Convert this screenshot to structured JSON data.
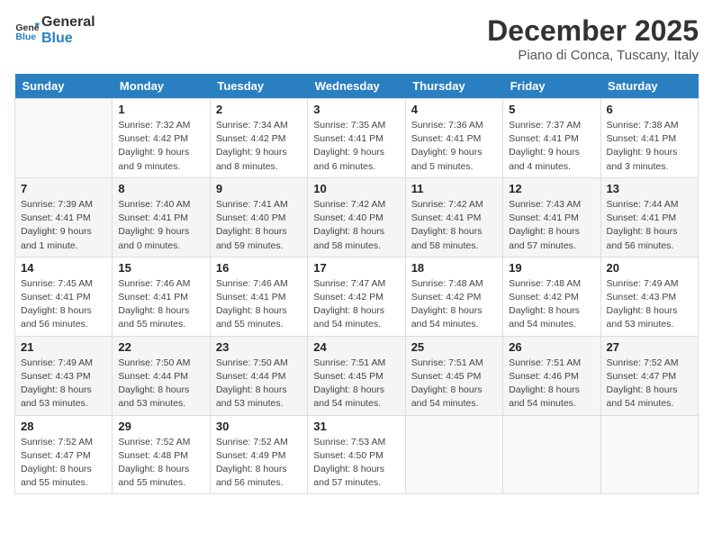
{
  "header": {
    "logo_line1": "General",
    "logo_line2": "Blue",
    "month": "December 2025",
    "location": "Piano di Conca, Tuscany, Italy"
  },
  "weekdays": [
    "Sunday",
    "Monday",
    "Tuesday",
    "Wednesday",
    "Thursday",
    "Friday",
    "Saturday"
  ],
  "weeks": [
    [
      {
        "day": "",
        "sunrise": "",
        "sunset": "",
        "daylight": ""
      },
      {
        "day": "1",
        "sunrise": "7:32 AM",
        "sunset": "4:42 PM",
        "daylight": "9 hours and 9 minutes."
      },
      {
        "day": "2",
        "sunrise": "7:34 AM",
        "sunset": "4:42 PM",
        "daylight": "9 hours and 8 minutes."
      },
      {
        "day": "3",
        "sunrise": "7:35 AM",
        "sunset": "4:41 PM",
        "daylight": "9 hours and 6 minutes."
      },
      {
        "day": "4",
        "sunrise": "7:36 AM",
        "sunset": "4:41 PM",
        "daylight": "9 hours and 5 minutes."
      },
      {
        "day": "5",
        "sunrise": "7:37 AM",
        "sunset": "4:41 PM",
        "daylight": "9 hours and 4 minutes."
      },
      {
        "day": "6",
        "sunrise": "7:38 AM",
        "sunset": "4:41 PM",
        "daylight": "9 hours and 3 minutes."
      }
    ],
    [
      {
        "day": "7",
        "sunrise": "7:39 AM",
        "sunset": "4:41 PM",
        "daylight": "9 hours and 1 minute."
      },
      {
        "day": "8",
        "sunrise": "7:40 AM",
        "sunset": "4:41 PM",
        "daylight": "9 hours and 0 minutes."
      },
      {
        "day": "9",
        "sunrise": "7:41 AM",
        "sunset": "4:40 PM",
        "daylight": "8 hours and 59 minutes."
      },
      {
        "day": "10",
        "sunrise": "7:42 AM",
        "sunset": "4:40 PM",
        "daylight": "8 hours and 58 minutes."
      },
      {
        "day": "11",
        "sunrise": "7:42 AM",
        "sunset": "4:41 PM",
        "daylight": "8 hours and 58 minutes."
      },
      {
        "day": "12",
        "sunrise": "7:43 AM",
        "sunset": "4:41 PM",
        "daylight": "8 hours and 57 minutes."
      },
      {
        "day": "13",
        "sunrise": "7:44 AM",
        "sunset": "4:41 PM",
        "daylight": "8 hours and 56 minutes."
      }
    ],
    [
      {
        "day": "14",
        "sunrise": "7:45 AM",
        "sunset": "4:41 PM",
        "daylight": "8 hours and 56 minutes."
      },
      {
        "day": "15",
        "sunrise": "7:46 AM",
        "sunset": "4:41 PM",
        "daylight": "8 hours and 55 minutes."
      },
      {
        "day": "16",
        "sunrise": "7:46 AM",
        "sunset": "4:41 PM",
        "daylight": "8 hours and 55 minutes."
      },
      {
        "day": "17",
        "sunrise": "7:47 AM",
        "sunset": "4:42 PM",
        "daylight": "8 hours and 54 minutes."
      },
      {
        "day": "18",
        "sunrise": "7:48 AM",
        "sunset": "4:42 PM",
        "daylight": "8 hours and 54 minutes."
      },
      {
        "day": "19",
        "sunrise": "7:48 AM",
        "sunset": "4:42 PM",
        "daylight": "8 hours and 54 minutes."
      },
      {
        "day": "20",
        "sunrise": "7:49 AM",
        "sunset": "4:43 PM",
        "daylight": "8 hours and 53 minutes."
      }
    ],
    [
      {
        "day": "21",
        "sunrise": "7:49 AM",
        "sunset": "4:43 PM",
        "daylight": "8 hours and 53 minutes."
      },
      {
        "day": "22",
        "sunrise": "7:50 AM",
        "sunset": "4:44 PM",
        "daylight": "8 hours and 53 minutes."
      },
      {
        "day": "23",
        "sunrise": "7:50 AM",
        "sunset": "4:44 PM",
        "daylight": "8 hours and 53 minutes."
      },
      {
        "day": "24",
        "sunrise": "7:51 AM",
        "sunset": "4:45 PM",
        "daylight": "8 hours and 54 minutes."
      },
      {
        "day": "25",
        "sunrise": "7:51 AM",
        "sunset": "4:45 PM",
        "daylight": "8 hours and 54 minutes."
      },
      {
        "day": "26",
        "sunrise": "7:51 AM",
        "sunset": "4:46 PM",
        "daylight": "8 hours and 54 minutes."
      },
      {
        "day": "27",
        "sunrise": "7:52 AM",
        "sunset": "4:47 PM",
        "daylight": "8 hours and 54 minutes."
      }
    ],
    [
      {
        "day": "28",
        "sunrise": "7:52 AM",
        "sunset": "4:47 PM",
        "daylight": "8 hours and 55 minutes."
      },
      {
        "day": "29",
        "sunrise": "7:52 AM",
        "sunset": "4:48 PM",
        "daylight": "8 hours and 55 minutes."
      },
      {
        "day": "30",
        "sunrise": "7:52 AM",
        "sunset": "4:49 PM",
        "daylight": "8 hours and 56 minutes."
      },
      {
        "day": "31",
        "sunrise": "7:53 AM",
        "sunset": "4:50 PM",
        "daylight": "8 hours and 57 minutes."
      },
      {
        "day": "",
        "sunrise": "",
        "sunset": "",
        "daylight": ""
      },
      {
        "day": "",
        "sunrise": "",
        "sunset": "",
        "daylight": ""
      },
      {
        "day": "",
        "sunrise": "",
        "sunset": "",
        "daylight": ""
      }
    ]
  ],
  "labels": {
    "sunrise": "Sunrise:",
    "sunset": "Sunset:",
    "daylight": "Daylight:"
  }
}
